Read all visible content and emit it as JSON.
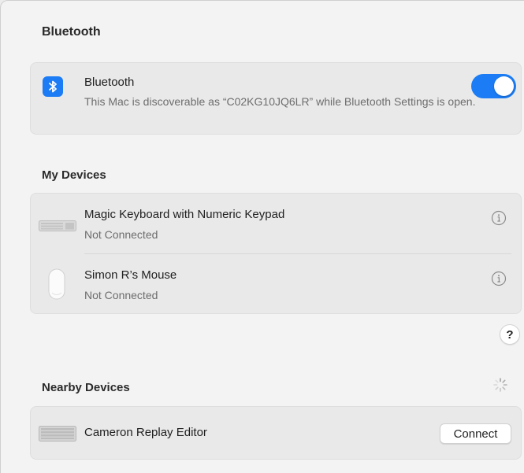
{
  "page": {
    "title": "Bluetooth"
  },
  "bluetooth": {
    "icon": "bluetooth-icon",
    "title": "Bluetooth",
    "description": "This Mac is discoverable as “C02KG10JQ6LR” while Bluetooth Settings is open.",
    "enabled": true,
    "accent_color": "#1b7cf5"
  },
  "my_devices": {
    "header": "My Devices",
    "devices": [
      {
        "name": "Magic Keyboard with Numeric Keypad",
        "status": "Not Connected",
        "icon": "keyboard-icon"
      },
      {
        "name": "Simon R’s Mouse",
        "status": "Not Connected",
        "icon": "mouse-icon"
      }
    ]
  },
  "help": {
    "label": "?"
  },
  "nearby_devices": {
    "header": "Nearby Devices",
    "devices": [
      {
        "name": "Cameron Replay Editor",
        "action": "Connect",
        "icon": "keyboard-icon"
      }
    ]
  }
}
